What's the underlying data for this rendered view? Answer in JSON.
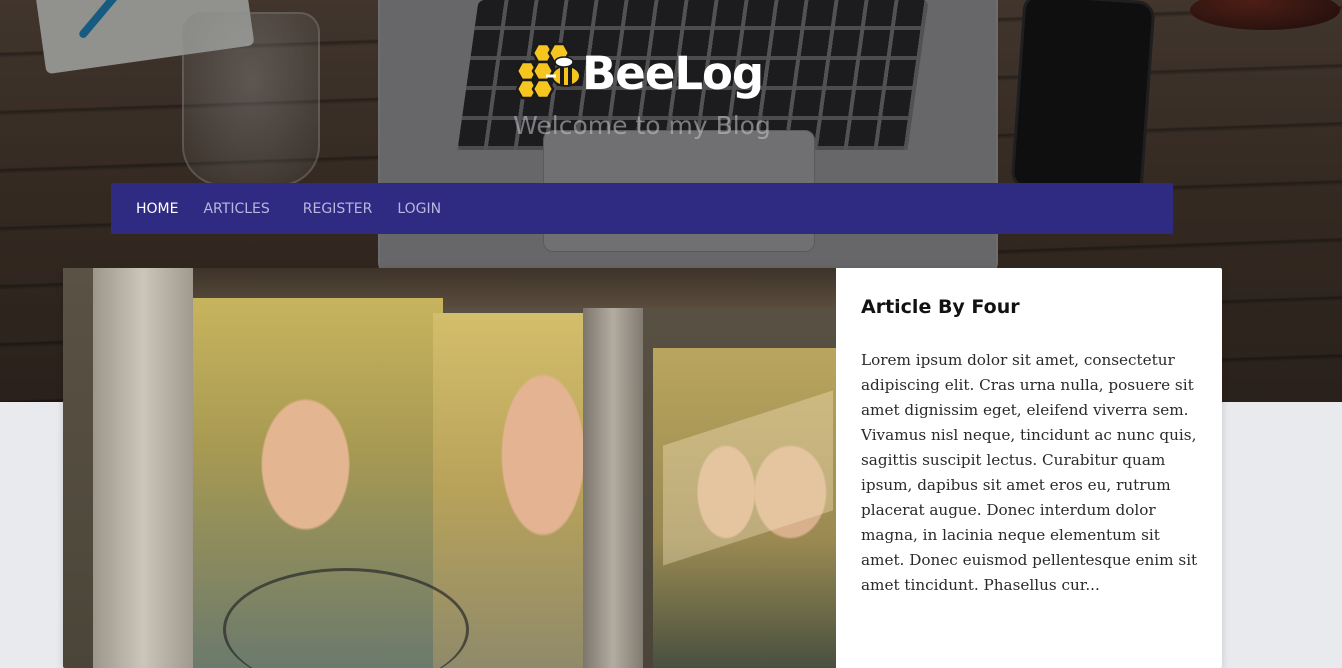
{
  "site": {
    "name": "BeeLog",
    "tagline": "Welcome to my Blog",
    "logo_icon": "honeycomb-bee-icon"
  },
  "nav": {
    "items": [
      {
        "label": "HOME",
        "active": true
      },
      {
        "label": "ARTICLES",
        "active": false
      },
      {
        "label": "REGISTER",
        "active": false
      },
      {
        "label": "LOGIN",
        "active": false
      }
    ]
  },
  "article": {
    "title": "Article By Four",
    "excerpt": "Lorem ipsum dolor sit amet, consectetur adipiscing elit. Cras urna nulla, posuere sit amet dignissim eget, eleifend viverra sem. Vivamus nisl neque, tincidunt ac nunc quis, sagittis suscipit lectus. Curabitur quam ipsum, dapibus sit amet eros eu, rutrum placerat augue. Donec interdum dolor magna, in lacinia neque elementum sit amet. Donec euismod pellentesque enim sit amet tincidunt. Phasellus cur..."
  },
  "colors": {
    "navbar_bg": "#302b82",
    "nav_active": "#ffffff",
    "nav_inactive": "#b9b6de",
    "logo_yellow": "#f7c51f",
    "page_bg": "#e9eaed"
  }
}
